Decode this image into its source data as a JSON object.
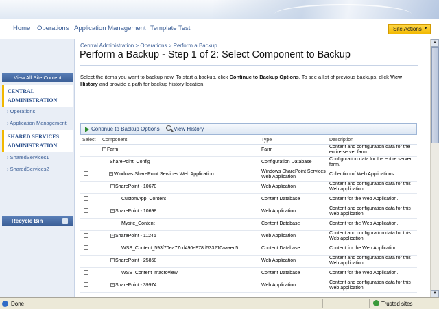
{
  "nav": {
    "items": [
      "Home",
      "Operations",
      "Application Management",
      "Template Test"
    ],
    "site_actions": "Site Actions"
  },
  "left": {
    "view_all": "View All Site Content",
    "central_admin": "CENTRAL ADMINISTRATION",
    "ca_links": [
      "Operations",
      "Application Management"
    ],
    "ssp": "SHARED SERVICES ADMINISTRATION",
    "ssp_links": [
      "SharedServices1",
      "SharedServices2"
    ],
    "recycle": "Recycle Bin"
  },
  "breadcrumb": "Central Administration > Operations > Perform a Backup",
  "title": "Perform a Backup - Step 1 of 2: Select Component to Backup",
  "description": {
    "part1": "Select the items you want to backup now. To start a backup, click ",
    "bold1": "Continue to Backup Options",
    "part2": ". To see a list of previous backups, click ",
    "bold2": "View History",
    "part3": " and provide a path for backup history location."
  },
  "toolbar": {
    "continue": "Continue to Backup Options",
    "history": "View History"
  },
  "table": {
    "headers": [
      "Select",
      "Component",
      "Type",
      "Description"
    ],
    "rows": [
      {
        "checkbox": true,
        "indent": 0,
        "toggle": true,
        "component": "Farm",
        "type": "Farm",
        "description": "Content and configuration data for the entire server farm."
      },
      {
        "checkbox": false,
        "indent": 1,
        "toggle": false,
        "component": "SharePoint_Config",
        "type": "Configuration Database",
        "description": "Configuration data for the entire server farm."
      },
      {
        "checkbox": true,
        "indent": 1,
        "toggle": true,
        "component": "Windows SharePoint Services Web Application",
        "type": "Windows SharePoint Services Web Application",
        "description": "Collection of Web Applications"
      },
      {
        "checkbox": true,
        "indent": 2,
        "toggle": true,
        "component": "SharePoint - 10670",
        "type": "Web Application",
        "description": "Content and configuration data for this Web application."
      },
      {
        "checkbox": true,
        "indent": 3,
        "toggle": false,
        "component": "CustomApp_Content",
        "type": "Content Database",
        "description": "Content for the Web Application."
      },
      {
        "checkbox": true,
        "indent": 2,
        "toggle": true,
        "component": "SharePoint - 10698",
        "type": "Web Application",
        "description": "Content and configuration data for this Web application."
      },
      {
        "checkbox": true,
        "indent": 3,
        "toggle": false,
        "component": "Mysite_Content",
        "type": "Content Database",
        "description": "Content for the Web Application."
      },
      {
        "checkbox": true,
        "indent": 2,
        "toggle": true,
        "component": "SharePoint - 11246",
        "type": "Web Application",
        "description": "Content and configuration data for this Web application."
      },
      {
        "checkbox": true,
        "indent": 3,
        "toggle": false,
        "component": "WSS_Content_593f70ea77cd490e978d533210aaaec5",
        "type": "Content Database",
        "description": "Content for the Web Application."
      },
      {
        "checkbox": true,
        "indent": 2,
        "toggle": true,
        "component": "SharePoint - 25858",
        "type": "Web Application",
        "description": "Content and configuration data for this Web application."
      },
      {
        "checkbox": true,
        "indent": 3,
        "toggle": false,
        "component": "WSS_Content_macroview",
        "type": "Content Database",
        "description": "Content for the Web Application."
      },
      {
        "checkbox": true,
        "indent": 2,
        "toggle": true,
        "component": "SharePoint - 39974",
        "type": "Web Application",
        "description": "Content and configuration data for this Web application."
      }
    ]
  },
  "status": {
    "left": "Done",
    "zone": "Trusted sites"
  }
}
